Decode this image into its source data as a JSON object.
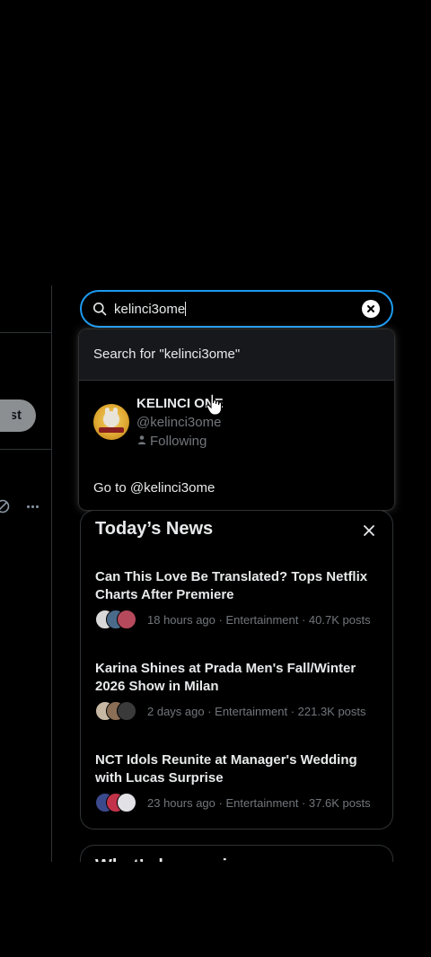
{
  "left": {
    "post_label": "Post"
  },
  "search": {
    "query": "kelinci3ome"
  },
  "dropdown": {
    "search_for": "Search for \"kelinci3ome\"",
    "user": {
      "name": "KELINCI ONE",
      "handle": "@kelinci3ome",
      "status": "Following"
    },
    "goto": "Go to @kelinci3ome"
  },
  "news": {
    "title": "Today’s News",
    "items": [
      {
        "headline": "Can This Love Be Translated? Tops Netflix Charts After Premiere",
        "meta": "18 hours ago · Entertainment · 40.7K posts"
      },
      {
        "headline": "Karina Shines at Prada Men's Fall/Winter 2026 Show in Milan",
        "meta": "2 days ago · Entertainment · 221.3K posts"
      },
      {
        "headline": "NCT Idols Reunite at Manager's Wedding with Lucas Surprise",
        "meta": "23 hours ago · Entertainment · 37.6K posts"
      }
    ]
  },
  "next_section": {
    "title": "What’s happening"
  },
  "colors": {
    "accent": "#1d9bf0",
    "background": "#000000",
    "text_primary": "#e7e9ea",
    "text_secondary": "#71767b",
    "border": "#2f3336"
  }
}
